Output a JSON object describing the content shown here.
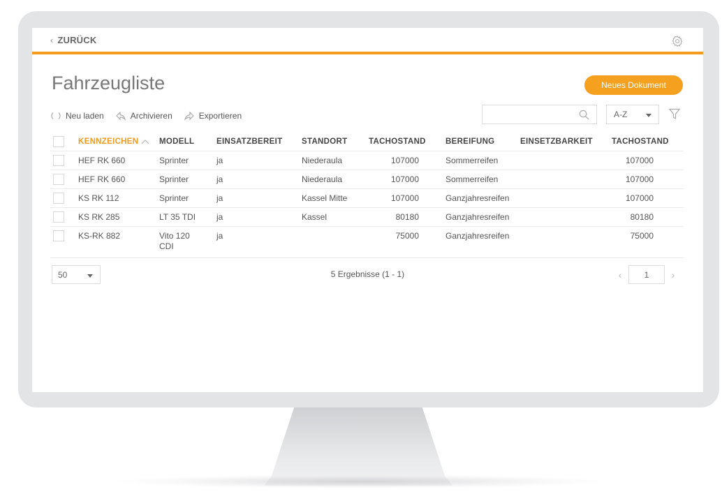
{
  "topbar": {
    "back_label": "ZURÜCK"
  },
  "page": {
    "title": "Fahrzeugliste",
    "new_document_label": "Neues Dokument"
  },
  "toolbar": {
    "reload_label": "Neu laden",
    "archive_label": "Archivieren",
    "export_label": "Exportieren",
    "search_value": "",
    "sort_label": "A-Z"
  },
  "colors": {
    "accent": "#f39a1f",
    "button": "#f5a01e"
  },
  "table": {
    "headers": [
      "KENNZEICHEN",
      "MODELL",
      "EINSATZBEREIT",
      "STANDORT",
      "TACHOSTAND",
      "BEREIFUNG",
      "EINSETZBARKEIT",
      "TACHOSTAND"
    ],
    "rows": [
      {
        "kennzeichen": "HEF RK 660",
        "modell": "Sprinter",
        "einsatzbereit": "ja",
        "standort": "Niederaula",
        "tachostand": "107000",
        "bereifung": "Sommerreifen",
        "einsetzbarkeit": "",
        "tachostand2": "107000"
      },
      {
        "kennzeichen": "HEF RK 660",
        "modell": "Sprinter",
        "einsatzbereit": "ja",
        "standort": "Niederaula",
        "tachostand": "107000",
        "bereifung": "Sommerreifen",
        "einsetzbarkeit": "",
        "tachostand2": "107000"
      },
      {
        "kennzeichen": "KS RK 112",
        "modell": "Sprinter",
        "einsatzbereit": "ja",
        "standort": "Kassel Mitte",
        "tachostand": "107000",
        "bereifung": "Ganzjahresreifen",
        "einsetzbarkeit": "",
        "tachostand2": "107000"
      },
      {
        "kennzeichen": "KS RK 285",
        "modell": "LT 35 TDI",
        "einsatzbereit": "ja",
        "standort": "Kassel",
        "tachostand": "80180",
        "bereifung": "Ganzjahresreifen",
        "einsetzbarkeit": "",
        "tachostand2": "80180"
      },
      {
        "kennzeichen": "KS-RK 882",
        "modell_line1": "Vito 120",
        "modell_line2": "CDI",
        "einsatzbereit": "ja",
        "standort": "",
        "tachostand": "75000",
        "bereifung": "Ganzjahresreifen",
        "einsetzbarkeit": "",
        "tachostand2": "75000"
      }
    ]
  },
  "footer": {
    "page_size": "50",
    "results_text": "5 Ergebnisse (1 - 1)",
    "current_page": "1",
    "prev_symbol": "‹",
    "next_symbol": "›"
  }
}
